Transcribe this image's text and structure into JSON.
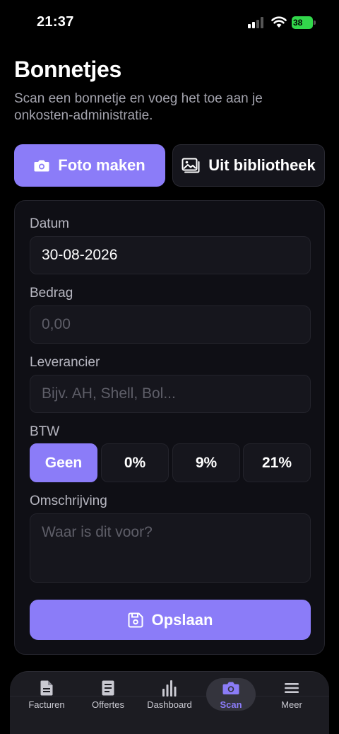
{
  "status_bar": {
    "time": "21:37",
    "battery": "38"
  },
  "header": {
    "title": "Bonnetjes",
    "subtitle": "Scan een bonnetje en voeg het toe aan je onkosten-administratie."
  },
  "actions": {
    "photo_label": "Foto maken",
    "library_label": "Uit bibliotheek"
  },
  "form": {
    "date_label": "Datum",
    "date_value": "30-08-2026",
    "amount_label": "Bedrag",
    "amount_placeholder": "0,00",
    "supplier_label": "Leverancier",
    "supplier_placeholder": "Bijv. AH, Shell, Bol...",
    "vat_label": "BTW",
    "vat_options": [
      "Geen",
      "0%",
      "9%",
      "21%"
    ],
    "vat_selected": "Geen",
    "description_label": "Omschrijving",
    "description_placeholder": "Waar is dit voor?",
    "save_label": "Opslaan"
  },
  "tab_bar": {
    "items": [
      {
        "label": "Facturen",
        "icon": "document-icon"
      },
      {
        "label": "Offertes",
        "icon": "quote-document-icon"
      },
      {
        "label": "Dashboard",
        "icon": "bar-chart-icon"
      },
      {
        "label": "Scan",
        "icon": "camera-icon"
      },
      {
        "label": "Meer",
        "icon": "menu-icon"
      }
    ],
    "active": "Scan"
  },
  "colors": {
    "accent": "#8b7cf8",
    "background": "#000000",
    "card": "#0f0f15"
  }
}
